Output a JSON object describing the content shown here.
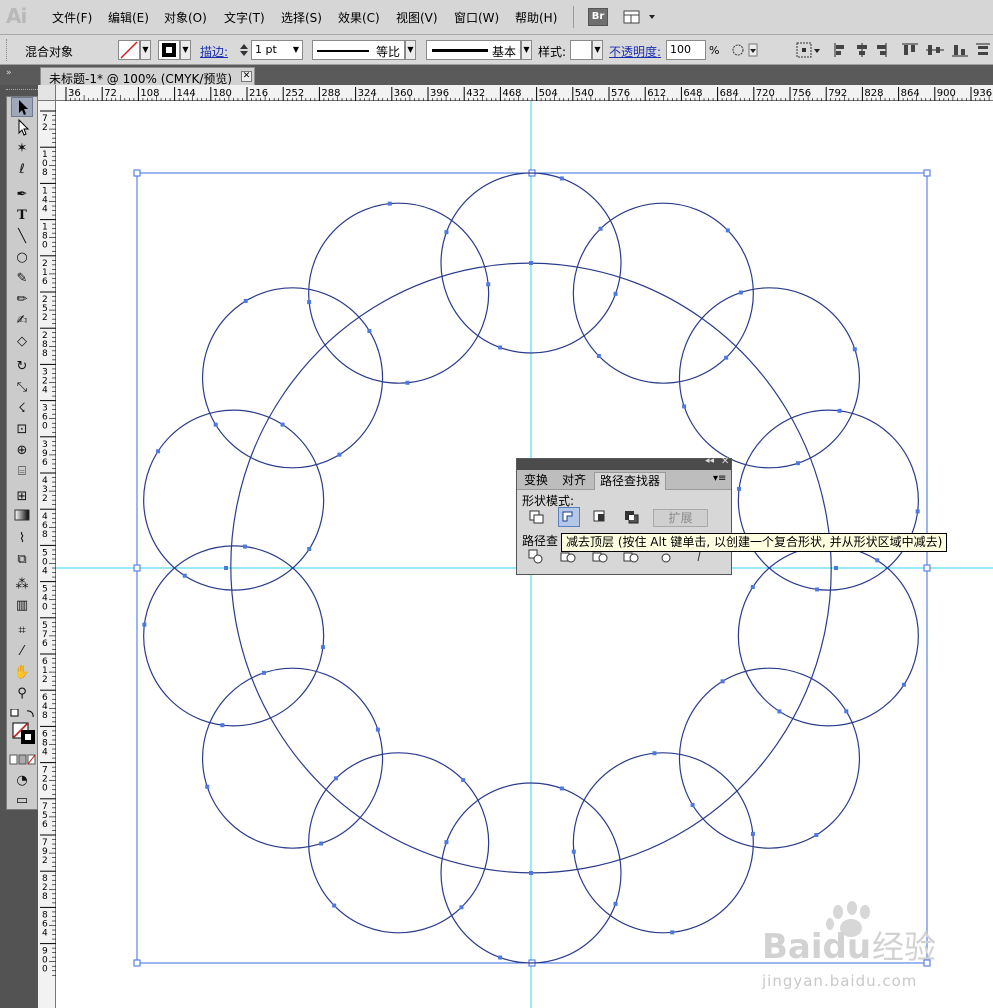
{
  "app": {
    "logo": "Ai"
  },
  "menu": {
    "items": [
      "文件(F)",
      "编辑(E)",
      "对象(O)",
      "文字(T)",
      "选择(S)",
      "效果(C)",
      "视图(V)",
      "窗口(W)",
      "帮助(H)"
    ],
    "bridge": "Br"
  },
  "control": {
    "selection_label": "混合对象",
    "stroke_label": "描边:",
    "stroke_value": "1 pt",
    "profile_label": "等比",
    "brush_label": "基本",
    "style_label": "样式:",
    "opacity_label": "不透明度:",
    "opacity_value": "100",
    "opacity_unit": "%"
  },
  "document": {
    "tab_title": "未标题-1* @ 100% (CMYK/预览)",
    "tab_close": "✕"
  },
  "rulers": {
    "h": [
      "36",
      "72",
      "108",
      "144",
      "180",
      "216",
      "252",
      "288",
      "324",
      "360",
      "396",
      "432",
      "468",
      "504",
      "540",
      "576",
      "612",
      "648",
      "684",
      "720",
      "756",
      "792",
      "828",
      "864",
      "900",
      "936"
    ],
    "v": [
      "72",
      "108",
      "144",
      "180",
      "216",
      "252",
      "288",
      "324",
      "360",
      "396",
      "432",
      "468",
      "504",
      "540",
      "576",
      "612",
      "648",
      "684",
      "720",
      "756",
      "792",
      "828",
      "864",
      "900"
    ]
  },
  "pathfinder": {
    "tabs": [
      "变换",
      "对齐",
      "路径查找器"
    ],
    "active_tab": "路径查找器",
    "shape_modes_label": "形状模式:",
    "pathfinders_label": "路径查",
    "expand_label": "扩展",
    "tooltip": "减去顶层 (按住 Alt 键单击, 以创建一个复合形状, 并从形状区域中减去)"
  },
  "watermark": {
    "brand": "Baidu经验",
    "url": "jingyan.baidu.com"
  },
  "colors": {
    "guide": "#33d6f0",
    "path": "#2a3b8c",
    "anchor": "#4d79e0",
    "bbox": "#3d6ee0"
  },
  "tools": [
    "selection-tool",
    "direct-selection-tool",
    "magic-wand-tool",
    "lasso-tool",
    "pen-tool",
    "type-tool",
    "line-tool",
    "ellipse-tool",
    "paintbrush-tool",
    "pencil-tool",
    "blob-brush-tool",
    "eraser-tool",
    "rotate-tool",
    "scale-tool",
    "warp-tool",
    "free-transform-tool",
    "shape-builder-tool",
    "perspective-grid-tool",
    "mesh-tool",
    "gradient-tool",
    "eyedropper-tool",
    "blend-tool",
    "symbol-sprayer-tool",
    "column-graph-tool",
    "artboard-tool",
    "slice-tool",
    "hand-tool",
    "zoom-tool"
  ]
}
